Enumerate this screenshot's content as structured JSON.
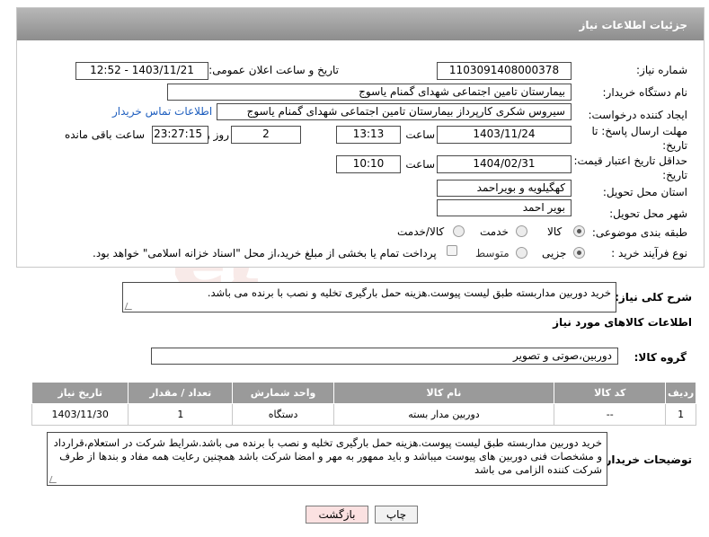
{
  "panel": {
    "title": "جزئیات اطلاعات نیاز"
  },
  "fields": {
    "need_number_label": "شماره نیاز:",
    "need_number": "1103091408000378",
    "announce_label": "تاریخ و ساعت اعلان عمومی:",
    "announce_value": "1403/11/21 - 12:52",
    "buyer_org_label": "نام دستگاه خریدار:",
    "buyer_org": "بیمارستان تامین اجتماعی شهدای گمنام یاسوج",
    "creator_label": "ایجاد کننده درخواست:",
    "creator": "سیروس شکری کارپرداز بیمارستان تامین اجتماعی شهدای گمنام یاسوج",
    "contact_link": "اطلاعات تماس خریدار",
    "deadline_label_1": "مهلت ارسال پاسخ: تا",
    "deadline_label_2": "تاریخ:",
    "deadline_date": "1403/11/24",
    "time_label": "ساعت",
    "deadline_time": "13:13",
    "days_value": "2",
    "days_label": "روز و",
    "remaining_time": "23:27:15",
    "remaining_label": "ساعت باقی مانده",
    "validity_label_1": "حداقل تاریخ اعتبار قیمت: تا",
    "validity_label_2": "تاریخ:",
    "validity_date": "1404/02/31",
    "validity_time_label": "ساعت",
    "validity_time": "10:10",
    "province_label": "استان محل تحویل:",
    "province": "کهگیلویه و بویراحمد",
    "city_label": "شهر محل تحویل:",
    "city": "بویر احمد",
    "category_label": "طبقه بندی موضوعی:",
    "category_options": [
      "کالا",
      "خدمت",
      "کالا/خدمت"
    ],
    "process_label": "نوع فرآیند خرید :",
    "process_options": [
      "جزیی",
      "متوسط"
    ],
    "payment_note": "پرداخت تمام یا بخشی از مبلغ خرید،از محل \"اسناد خزانه اسلامی\" خواهد بود."
  },
  "description": {
    "label": "شرح کلی نیاز:",
    "text": "خرید دوربین  مداربسته طبق لیست پیوست.هزینه حمل بارگیری تخلیه و نصب با برنده می باشد."
  },
  "goods": {
    "section_title": "اطلاعات کالاهای مورد نیاز",
    "group_label": "گروه کالا:",
    "group_value": "دوربین،صوتی و تصویر"
  },
  "table": {
    "headers": [
      "ردیف",
      "کد کالا",
      "نام کالا",
      "واحد شمارش",
      "تعداد / مقدار",
      "تاریخ نیاز"
    ],
    "rows": [
      [
        "1",
        "--",
        "دوربین مدار بسته",
        "دستگاه",
        "1",
        "1403/11/30"
      ]
    ]
  },
  "buyer_notes": {
    "label": "توضیحات خریدار:",
    "text": "خرید دوربین  مداربسته طبق لیست پیوست.هزینه حمل بارگیری تخلیه و نصب با برنده می باشد.شرایط شرکت در استعلام،قرارداد و مشخصات فنی دوربین های پیوست میباشد و باید ممهور به مهر و امضا شرکت باشد همچنین رعایت همه مفاد و بندها از طرف شرکت کننده الزامی می باشد"
  },
  "buttons": {
    "print": "چاپ",
    "back": "بازگشت"
  },
  "watermark_text": "AriaTender.net"
}
